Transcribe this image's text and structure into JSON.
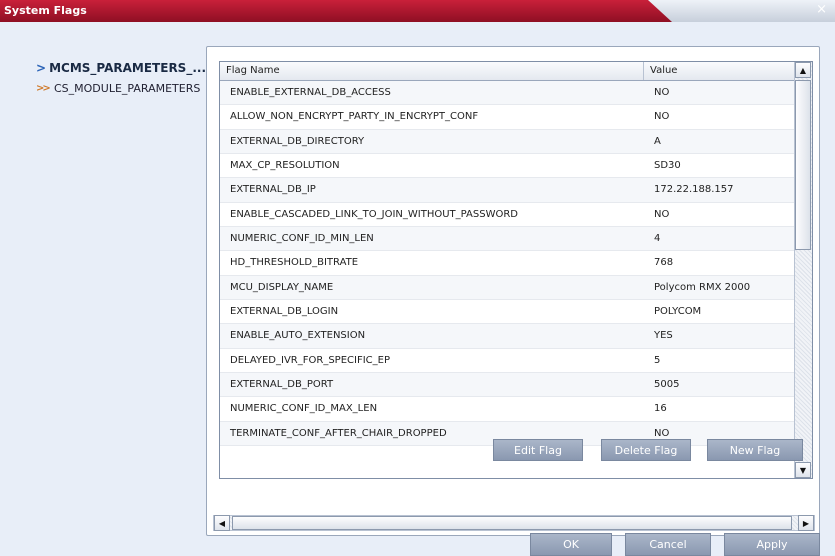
{
  "window": {
    "title": "System Flags",
    "close_glyph": "×"
  },
  "nav": {
    "items": [
      {
        "label": "MCMS_PARAMETERS_...",
        "icon": "arrow-right-icon"
      },
      {
        "label": "CS_MODULE_PARAMETERS",
        "icon": "double-arrow-right-icon"
      }
    ]
  },
  "grid": {
    "columns": [
      "Flag Name",
      "Value"
    ],
    "rows": [
      [
        "ENABLE_EXTERNAL_DB_ACCESS",
        "NO"
      ],
      [
        "ALLOW_NON_ENCRYPT_PARTY_IN_ENCRYPT_CONF",
        "NO"
      ],
      [
        "EXTERNAL_DB_DIRECTORY",
        "A"
      ],
      [
        "MAX_CP_RESOLUTION",
        "SD30"
      ],
      [
        "EXTERNAL_DB_IP",
        "172.22.188.157"
      ],
      [
        "ENABLE_CASCADED_LINK_TO_JOIN_WITHOUT_PASSWORD",
        "NO"
      ],
      [
        "NUMERIC_CONF_ID_MIN_LEN",
        "4"
      ],
      [
        "HD_THRESHOLD_BITRATE",
        "768"
      ],
      [
        "MCU_DISPLAY_NAME",
        "Polycom RMX 2000"
      ],
      [
        "EXTERNAL_DB_LOGIN",
        "POLYCOM"
      ],
      [
        "ENABLE_AUTO_EXTENSION",
        "YES"
      ],
      [
        "DELAYED_IVR_FOR_SPECIFIC_EP",
        "5"
      ],
      [
        "EXTERNAL_DB_PORT",
        "5005"
      ],
      [
        "NUMERIC_CONF_ID_MAX_LEN",
        "16"
      ],
      [
        "TERMINATE_CONF_AFTER_CHAIR_DROPPED",
        "NO"
      ]
    ]
  },
  "flag_buttons": {
    "edit": "Edit Flag",
    "delete": "Delete Flag",
    "new": "New Flag"
  },
  "dialog_buttons": {
    "ok": "OK",
    "cancel": "Cancel",
    "apply": "Apply"
  },
  "colors": {
    "title_bar": "#b8172e",
    "button": "#95a3b9",
    "panel_bg": "#e8eef8"
  }
}
